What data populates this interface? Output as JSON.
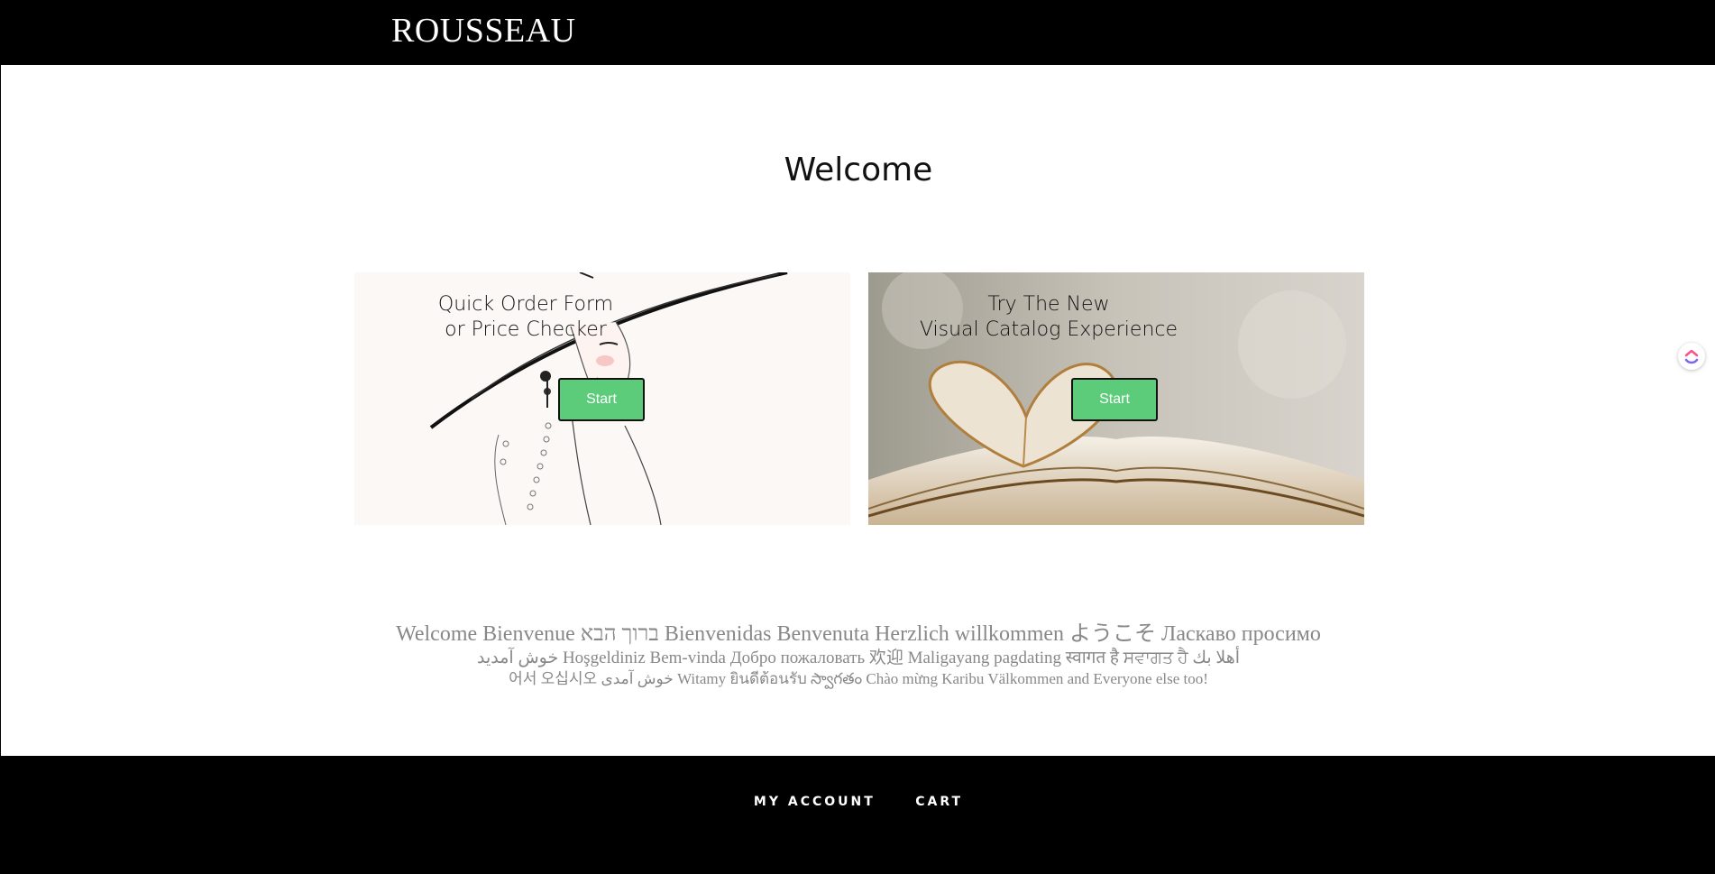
{
  "header": {
    "brand": "ROUSSEAU"
  },
  "main": {
    "title": "Welcome",
    "cards": [
      {
        "heading_lines": [
          "Quick Order Form",
          "or Price Checker"
        ],
        "button_label": "Start"
      },
      {
        "heading_lines": [
          "Try The New",
          "Visual Catalog Experience"
        ],
        "button_label": "Start"
      }
    ],
    "multilingual": [
      "Welcome Bienvenue ברוך הבא Bienvenidas Benvenuta Herzlich willkommen ようこそ Ласкаво просимо",
      "خوش آمدید Hoşgeldiniz Bem-vinda Добро пожаловать 欢迎 Maligayang pagdating स्वागत है ਸਵਾਗਤ ਹੈ أهلا بك",
      "어서 오십시오 خوش آمدی Witamy ยินดีต้อนรับ స్వాగతం Chào mừng Karibu Välkommen and Everyone else too!"
    ]
  },
  "footer": {
    "links": [
      "MY ACCOUNT",
      "CART"
    ]
  },
  "colors": {
    "header_bg": "#000000",
    "start_button": "#5dcc7a",
    "multilingual_text": "#888888"
  },
  "icons": {
    "floating_widget": "clickup-logo-icon"
  }
}
